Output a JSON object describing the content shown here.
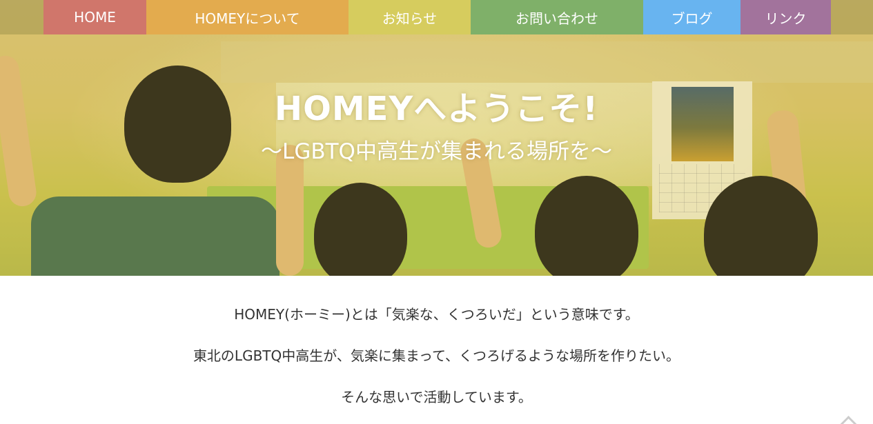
{
  "nav": {
    "items": [
      {
        "label": "HOME",
        "color": "#d0766b"
      },
      {
        "label": "HOMEYについて",
        "color": "#e3ab4e"
      },
      {
        "label": "お知らせ",
        "color": "#d6cc5e"
      },
      {
        "label": "お問い合わせ",
        "color": "#7fb069"
      },
      {
        "label": "ブログ",
        "color": "#68b4f0"
      },
      {
        "label": "リンク",
        "color": "#a2739c"
      }
    ]
  },
  "hero": {
    "title": "HOMEYへようこそ!",
    "subtitle": "〜LGBTQ中高生が集まれる場所を〜"
  },
  "intro": {
    "line1": "HOMEY(ホーミー)とは「気楽な、くつろいだ」という意味です。",
    "line2": "東北のLGBTQ中高生が、気楽に集まって、くつろげるような場所を作りたい。",
    "line3": "そんな思いで活動しています。"
  },
  "icons": {
    "scroll_top": "chevron-up-icon"
  }
}
